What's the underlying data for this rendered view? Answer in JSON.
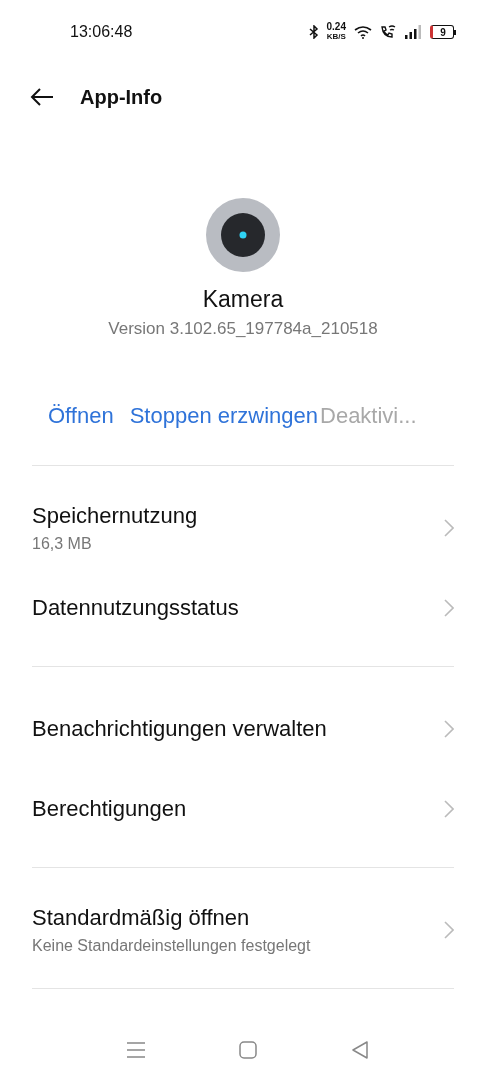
{
  "status_bar": {
    "time": "13:06:48",
    "net_speed": "0.24",
    "net_unit": "KB/S",
    "battery": "9"
  },
  "header": {
    "title": "App-Info"
  },
  "app": {
    "name": "Kamera",
    "version": "Version 3.102.65_197784a_210518"
  },
  "actions": [
    {
      "label": "Öffnen",
      "disabled": false
    },
    {
      "label": "Stoppen erzwingen",
      "disabled": false
    },
    {
      "label": "Deaktivi...",
      "disabled": true
    }
  ],
  "sections": [
    {
      "items": [
        {
          "title": "Speichernutzung",
          "subtitle": "16,3 MB"
        },
        {
          "title": "Datennutzungsstatus"
        }
      ]
    },
    {
      "items": [
        {
          "title": "Benachrichtigungen verwalten"
        },
        {
          "title": "Berechtigungen"
        }
      ]
    },
    {
      "items": [
        {
          "title": "Standardmäßig öffnen",
          "subtitle": "Keine Standardeinstellungen festgelegt"
        }
      ]
    }
  ]
}
